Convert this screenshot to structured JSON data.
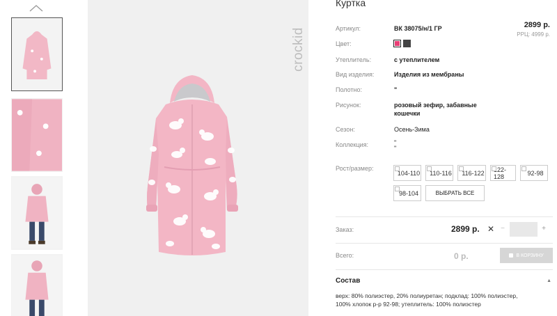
{
  "product": {
    "title": "Куртка",
    "price": "2899 р.",
    "rrc": "РРЦ: 4999 р.",
    "brand": "crockid"
  },
  "details": {
    "article_label": "Артикул:",
    "article_value": "ВК 38075/н/1 ГР",
    "color_label": "Цвет:",
    "colors": [
      "#e83e75",
      "#444444"
    ],
    "insulation_label": "Утеплитель:",
    "insulation_value": "с утеплителем",
    "type_label": "Вид изделия:",
    "type_value": "Изделия из мембраны",
    "fabric_label": "Полотно:",
    "fabric_value": "\"",
    "pattern_label": "Рисунок:",
    "pattern_value_1": "розовый зефир, забавные",
    "pattern_value_2": "кошечки",
    "season_label": "Сезон:",
    "season_value": "Осень-Зима",
    "collection_label": "Коллекция:",
    "collection_value_1": "\"",
    "collection_value_2": "\""
  },
  "sizes": {
    "label": "Рост/размер:",
    "options": [
      "104-110",
      "110-116",
      "116-122",
      "122-128",
      "92-98",
      "98-104"
    ],
    "select_all": "ВЫБРАТЬ ВСЕ"
  },
  "order": {
    "label": "Заказ:",
    "price": "2899 р.",
    "times": "✕",
    "minus": "−",
    "plus": "+",
    "quantity": ""
  },
  "total": {
    "label": "Всего:",
    "value": "0 р.",
    "cart_button": "В КОРЗИНУ"
  },
  "composition": {
    "title": "Состав",
    "text_1": "верх: 80% полиэстер, 20% полиуретан; подклад: 100% полиэстер,",
    "text_2": "100% хлопок р-р 92-98; утеплитель: 100% полиэстер"
  }
}
